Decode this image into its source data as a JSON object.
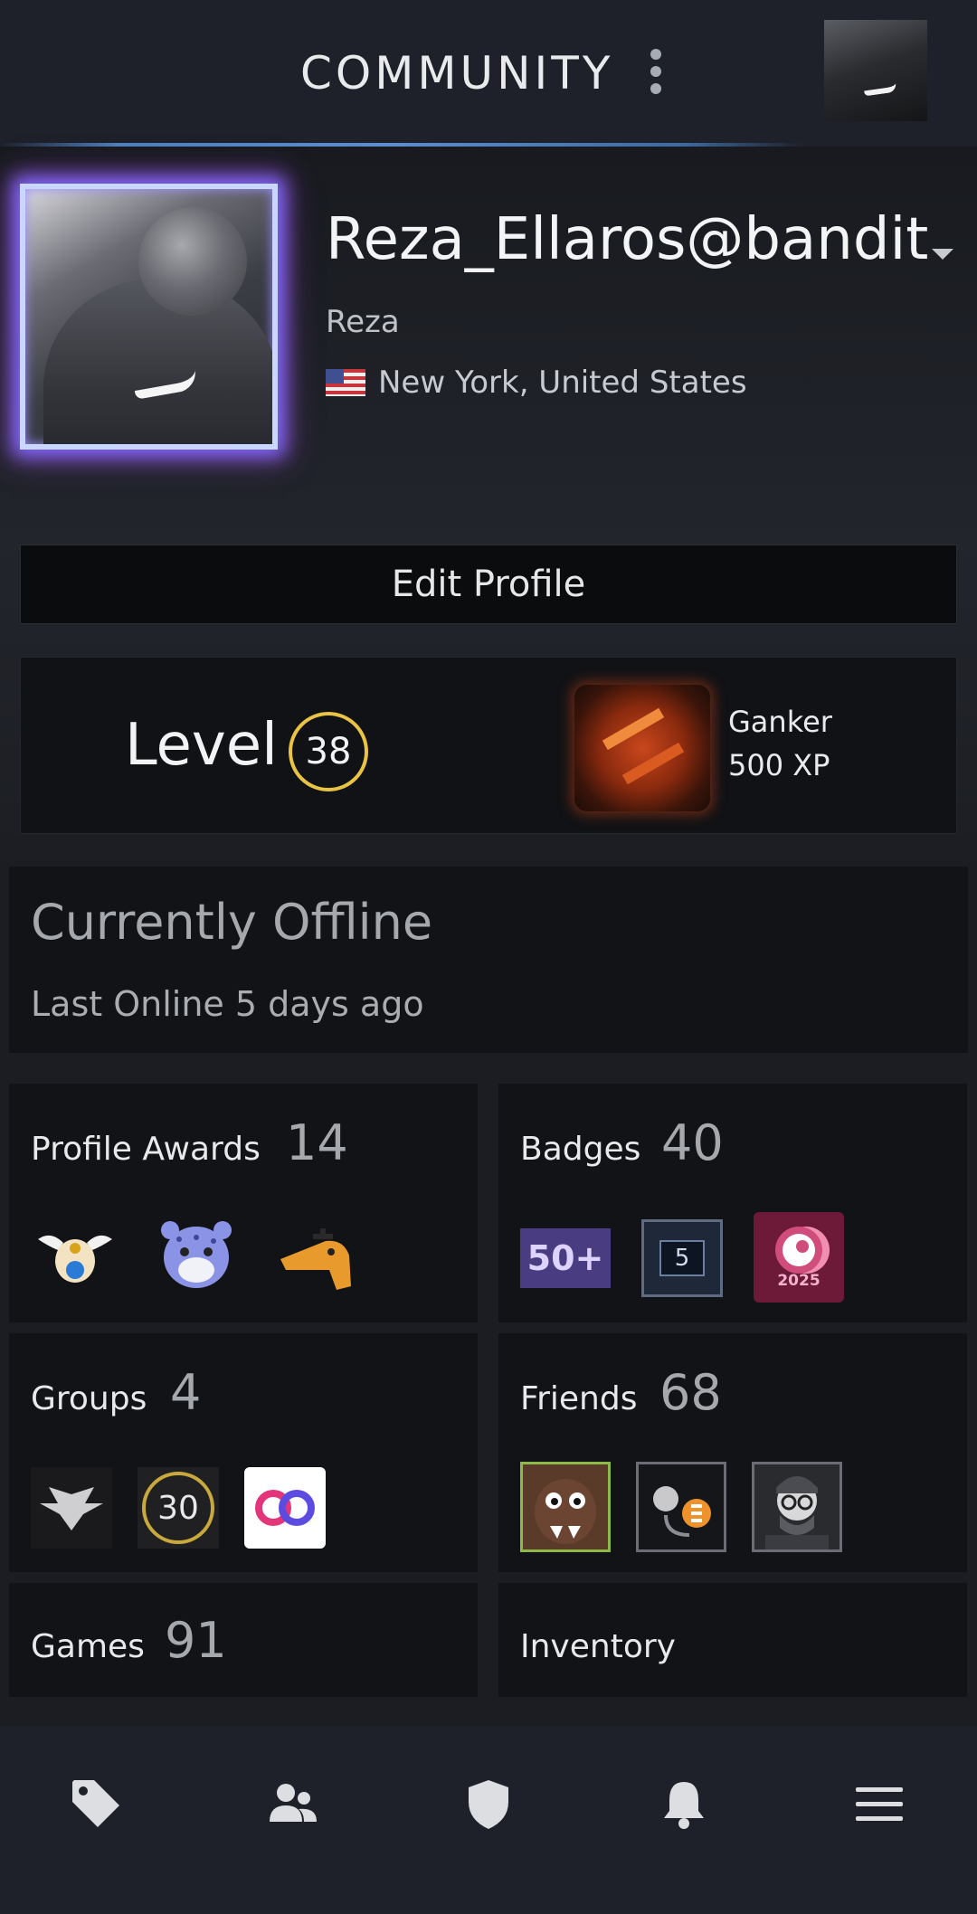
{
  "header": {
    "title": "COMMUNITY",
    "menu_icon": "kebab-menu-icon",
    "avatar_icon": "user-avatar"
  },
  "profile": {
    "username": "Reza_Ellaros@bandit",
    "real_name": "Reza",
    "location": "New York, United States",
    "flag_icon": "us-flag-icon",
    "edit_label": "Edit Profile"
  },
  "level": {
    "label": "Level",
    "value": "38",
    "featured_badge_name": "Ganker",
    "featured_badge_xp": "500 XP"
  },
  "status": {
    "title": "Currently Offline",
    "last_online": "Last Online 5 days ago"
  },
  "cards": {
    "awards": {
      "label": "Profile Awards",
      "count": "14"
    },
    "badges": {
      "label": "Badges",
      "count": "40",
      "items": [
        "50+",
        "5",
        "2025"
      ]
    },
    "groups": {
      "label": "Groups",
      "count": "4",
      "items": [
        "",
        "30",
        ""
      ]
    },
    "friends": {
      "label": "Friends",
      "count": "68"
    },
    "games": {
      "label": "Games",
      "count": "91"
    },
    "inventory": {
      "label": "Inventory"
    }
  },
  "colors": {
    "accent_blue": "#5b8ed0",
    "level_gold": "#e9c343",
    "background": "#1b1d23"
  },
  "bottom_nav": {
    "items": [
      "tag-icon",
      "friends-icon",
      "shield-icon",
      "bell-icon",
      "hamburger-menu-icon"
    ]
  }
}
